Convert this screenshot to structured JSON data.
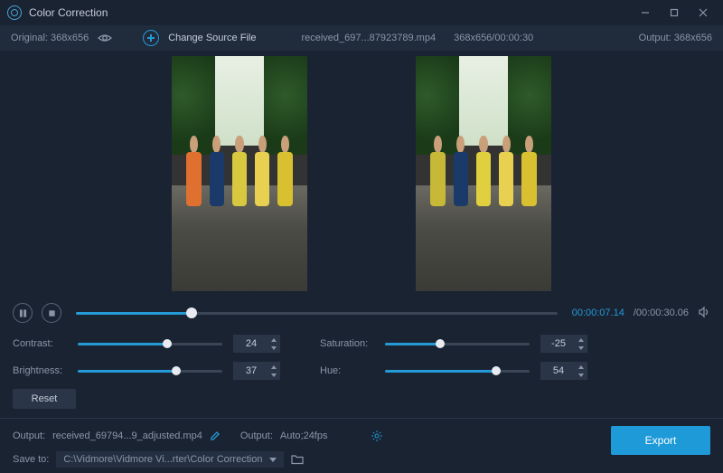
{
  "window": {
    "title": "Color Correction"
  },
  "toolbar": {
    "original_label": "Original: 368x656",
    "change_source": "Change Source File",
    "file_name": "received_697...87923789.mp4",
    "file_meta": "368x656/00:00:30",
    "output_label": "Output: 368x656"
  },
  "timeline": {
    "current": "00:00:07.14",
    "total": "/00:00:30.06",
    "progress_pct": 24
  },
  "sliders": {
    "contrast": {
      "label": "Contrast:",
      "value": "24",
      "pct": 62
    },
    "brightness": {
      "label": "Brightness:",
      "value": "37",
      "pct": 68
    },
    "saturation": {
      "label": "Saturation:",
      "value": "-25",
      "pct": 38
    },
    "hue": {
      "label": "Hue:",
      "value": "54",
      "pct": 77
    }
  },
  "reset_label": "Reset",
  "output": {
    "file_label": "Output:",
    "file_value": "received_69794...9_adjusted.mp4",
    "fmt_label": "Output:",
    "fmt_value": "Auto;24fps",
    "save_label": "Save to:",
    "save_path": "C:\\Vidmore\\Vidmore Vi...rter\\Color Correction"
  },
  "export_label": "Export"
}
